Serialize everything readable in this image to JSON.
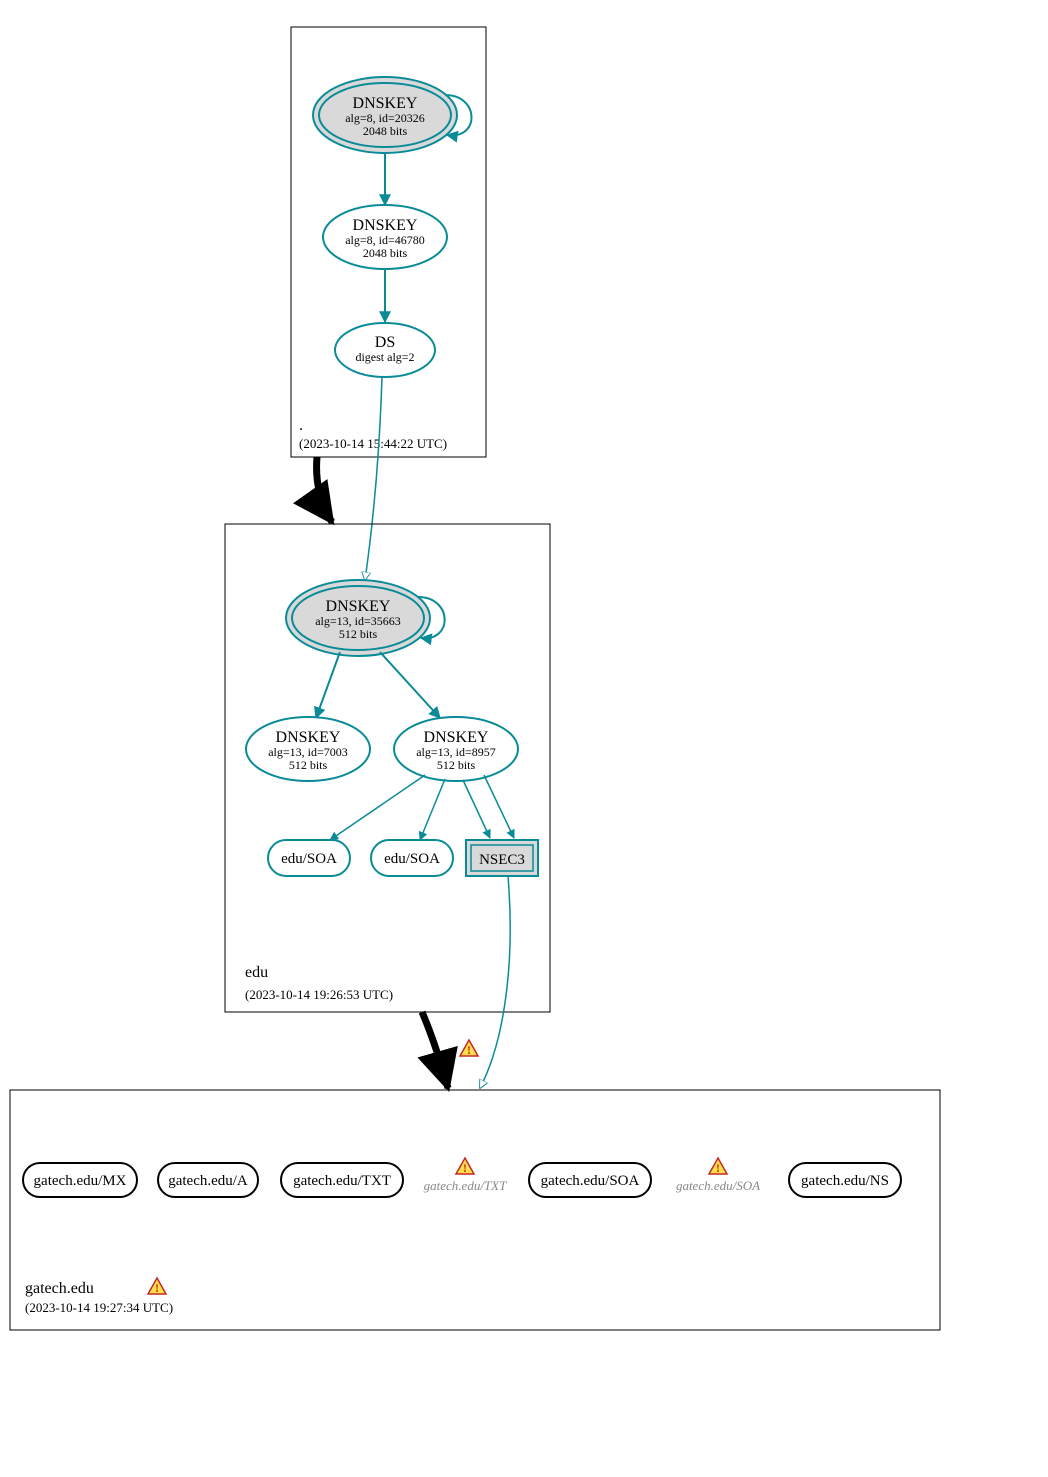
{
  "colors": {
    "teal": "#0a8b98",
    "shade": "#d9d9d9"
  },
  "zones": {
    "root": {
      "name": ".",
      "timestamp": "(2023-10-14 15:44:22 UTC)"
    },
    "edu": {
      "name": "edu",
      "timestamp": "(2023-10-14 19:26:53 UTC)"
    },
    "gatech": {
      "name": "gatech.edu",
      "timestamp": "(2023-10-14 19:27:34 UTC)"
    }
  },
  "root_dnskey1": {
    "title": "DNSKEY",
    "sub1": "alg=8, id=20326",
    "sub2": "2048 bits"
  },
  "root_dnskey2": {
    "title": "DNSKEY",
    "sub1": "alg=8, id=46780",
    "sub2": "2048 bits"
  },
  "root_ds": {
    "title": "DS",
    "sub1": "digest alg=2"
  },
  "edu_dnskey_ksk": {
    "title": "DNSKEY",
    "sub1": "alg=13, id=35663",
    "sub2": "512 bits"
  },
  "edu_dnskey_zsk_a": {
    "title": "DNSKEY",
    "sub1": "alg=13, id=7003",
    "sub2": "512 bits"
  },
  "edu_dnskey_zsk_b": {
    "title": "DNSKEY",
    "sub1": "alg=13, id=8957",
    "sub2": "512 bits"
  },
  "edu_soa_a": "edu/SOA",
  "edu_soa_b": "edu/SOA",
  "nsec3": "NSEC3",
  "gatech_records": {
    "mx": "gatech.edu/MX",
    "a": "gatech.edu/A",
    "txt": "gatech.edu/TXT",
    "txt_warn": "gatech.edu/TXT",
    "soa": "gatech.edu/SOA",
    "soa_warn": "gatech.edu/SOA",
    "ns": "gatech.edu/NS"
  }
}
